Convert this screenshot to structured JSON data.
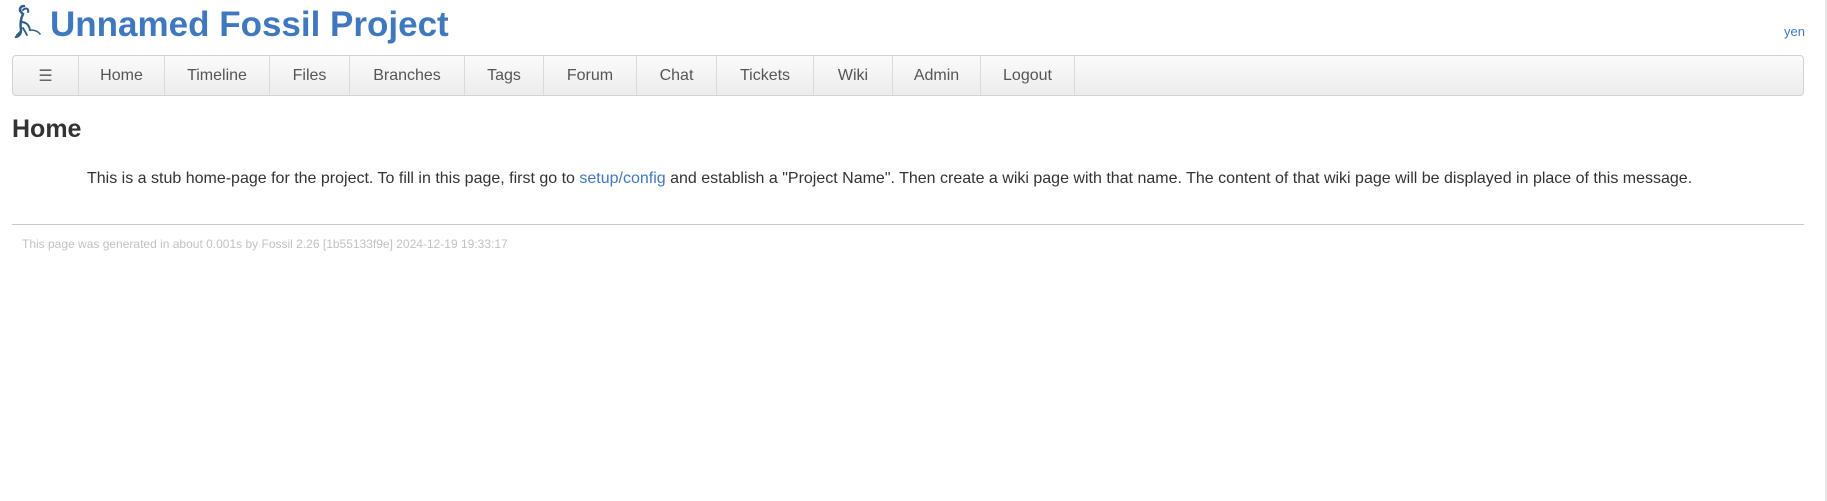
{
  "header": {
    "title": "Unnamed Fossil Project",
    "login_link": "yen",
    "logo": "fossil-logo-icon"
  },
  "mainmenu": {
    "hamburger": "☰",
    "items": [
      {
        "label": "Home"
      },
      {
        "label": "Timeline"
      },
      {
        "label": "Files"
      },
      {
        "label": "Branches"
      },
      {
        "label": "Tags"
      },
      {
        "label": "Forum"
      },
      {
        "label": "Chat"
      },
      {
        "label": "Tickets"
      },
      {
        "label": "Wiki"
      },
      {
        "label": "Admin"
      },
      {
        "label": "Logout"
      }
    ]
  },
  "page": {
    "title": "Home",
    "body_before": "This is a stub home-page for the project. To fill in this page, first go to ",
    "body_link": "setup/config",
    "body_after": " and establish a \"Project Name\". Then create a wiki page with that name. The content of that wiki page will be displayed in place of this message."
  },
  "footer": {
    "text": "This page was generated in about 0.001s by Fossil 2.26 [1b55133f9e] 2024-12-19 19:33:17"
  },
  "colors": {
    "accent": "#4078c0",
    "text": "#333333",
    "footer_text": "#c2c2c2"
  }
}
